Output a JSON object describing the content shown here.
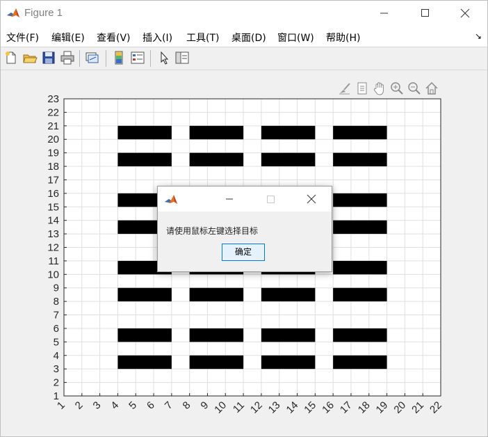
{
  "window": {
    "title": "Figure 1"
  },
  "menu": [
    {
      "label": "文件(F)"
    },
    {
      "label": "编辑(E)"
    },
    {
      "label": "查看(V)"
    },
    {
      "label": "插入(I)"
    },
    {
      "label": "工具(T)"
    },
    {
      "label": "桌面(D)"
    },
    {
      "label": "窗口(W)"
    },
    {
      "label": "帮助(H)"
    }
  ],
  "toolbar_icons": [
    "new-figure-icon",
    "open-file-icon",
    "save-icon",
    "print-icon",
    "link-plot-icon",
    "insert-colorbar-icon",
    "insert-legend-icon",
    "edit-plot-arrow-icon",
    "property-inspector-icon"
  ],
  "axes_toolbar_icons": [
    "brush-icon",
    "data-tips-icon",
    "pan-hand-icon",
    "zoom-in-icon",
    "zoom-out-icon",
    "home-restore-view-icon"
  ],
  "dialog": {
    "message": "请使用鼠标左键选择目标",
    "ok_label": "确定"
  },
  "chart_data": {
    "type": "grid",
    "x_ticks": [
      1,
      2,
      3,
      4,
      5,
      6,
      7,
      8,
      9,
      10,
      11,
      12,
      13,
      14,
      15,
      16,
      17,
      18,
      19,
      20,
      21,
      22
    ],
    "y_ticks": [
      1,
      2,
      3,
      4,
      5,
      6,
      7,
      8,
      9,
      10,
      11,
      12,
      13,
      14,
      15,
      16,
      17,
      18,
      19,
      20,
      21,
      22,
      23
    ],
    "xlim": [
      1,
      22
    ],
    "ylim": [
      1,
      23
    ],
    "grid": true,
    "block_color": "#000000",
    "block_columns": [
      [
        4,
        7
      ],
      [
        8,
        11
      ],
      [
        12,
        15
      ],
      [
        16,
        19
      ]
    ],
    "block_rows": [
      [
        20,
        21
      ],
      [
        18,
        19
      ],
      [
        15,
        16
      ],
      [
        13,
        14
      ],
      [
        10,
        11
      ],
      [
        8,
        9
      ],
      [
        5,
        6
      ],
      [
        3,
        4
      ]
    ]
  }
}
